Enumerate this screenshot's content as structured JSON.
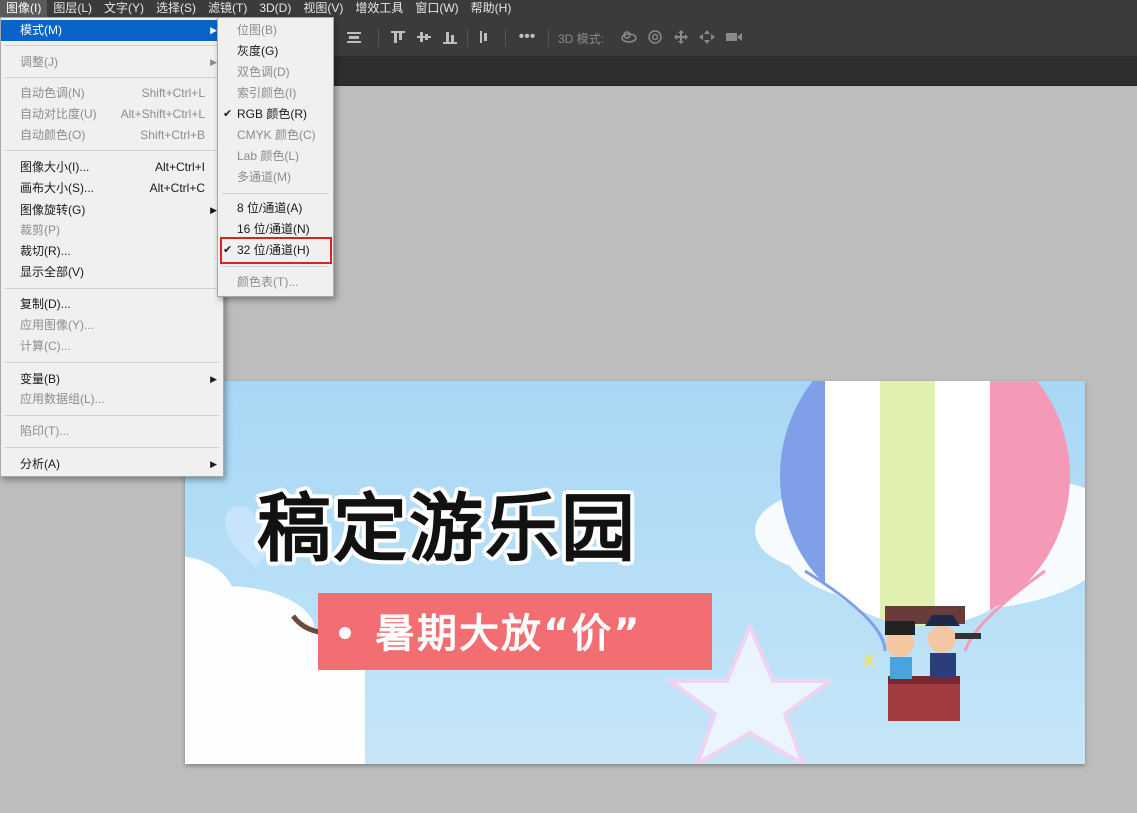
{
  "menubar": {
    "items": [
      "图像(I)",
      "图层(L)",
      "文字(Y)",
      "选择(S)",
      "滤镜(T)",
      "3D(D)",
      "视图(V)",
      "增效工具",
      "窗口(W)",
      "帮助(H)"
    ]
  },
  "optionsbar": {
    "mode_3d_label": "3D 模式:"
  },
  "image_menu": {
    "items": [
      {
        "label": "模式(M)"
      },
      {
        "label": "调整(J)"
      },
      {
        "label": "自动色调(N)",
        "shortcut": "Shift+Ctrl+L"
      },
      {
        "label": "自动对比度(U)",
        "shortcut": "Alt+Shift+Ctrl+L"
      },
      {
        "label": "自动颜色(O)",
        "shortcut": "Shift+Ctrl+B"
      },
      {
        "label": "图像大小(I)...",
        "shortcut": "Alt+Ctrl+I"
      },
      {
        "label": "画布大小(S)...",
        "shortcut": "Alt+Ctrl+C"
      },
      {
        "label": "图像旋转(G)"
      },
      {
        "label": "裁剪(P)"
      },
      {
        "label": "裁切(R)..."
      },
      {
        "label": "显示全部(V)"
      },
      {
        "label": "复制(D)..."
      },
      {
        "label": "应用图像(Y)..."
      },
      {
        "label": "计算(C)..."
      },
      {
        "label": "变量(B)"
      },
      {
        "label": "应用数据组(L)..."
      },
      {
        "label": "陷印(T)..."
      },
      {
        "label": "分析(A)"
      }
    ]
  },
  "mode_submenu": {
    "items": [
      {
        "label": "位图(B)"
      },
      {
        "label": "灰度(G)"
      },
      {
        "label": "双色调(D)"
      },
      {
        "label": "索引颜色(I)"
      },
      {
        "label": "RGB 颜色(R)"
      },
      {
        "label": "CMYK 颜色(C)"
      },
      {
        "label": "Lab 颜色(L)"
      },
      {
        "label": "多通道(M)"
      },
      {
        "label": "8 位/通道(A)"
      },
      {
        "label": "16 位/通道(N)"
      },
      {
        "label": "32 位/通道(H)"
      },
      {
        "label": "颜色表(T)..."
      }
    ]
  },
  "canvas": {
    "title": "稿定游乐园",
    "tagline": "暑期大放“价”"
  },
  "colors": {
    "menu_highlight": "#0a64c8",
    "annotation_box": "#e02020",
    "banner_tag": "#f26e72",
    "sky": "#a8d7f5"
  }
}
